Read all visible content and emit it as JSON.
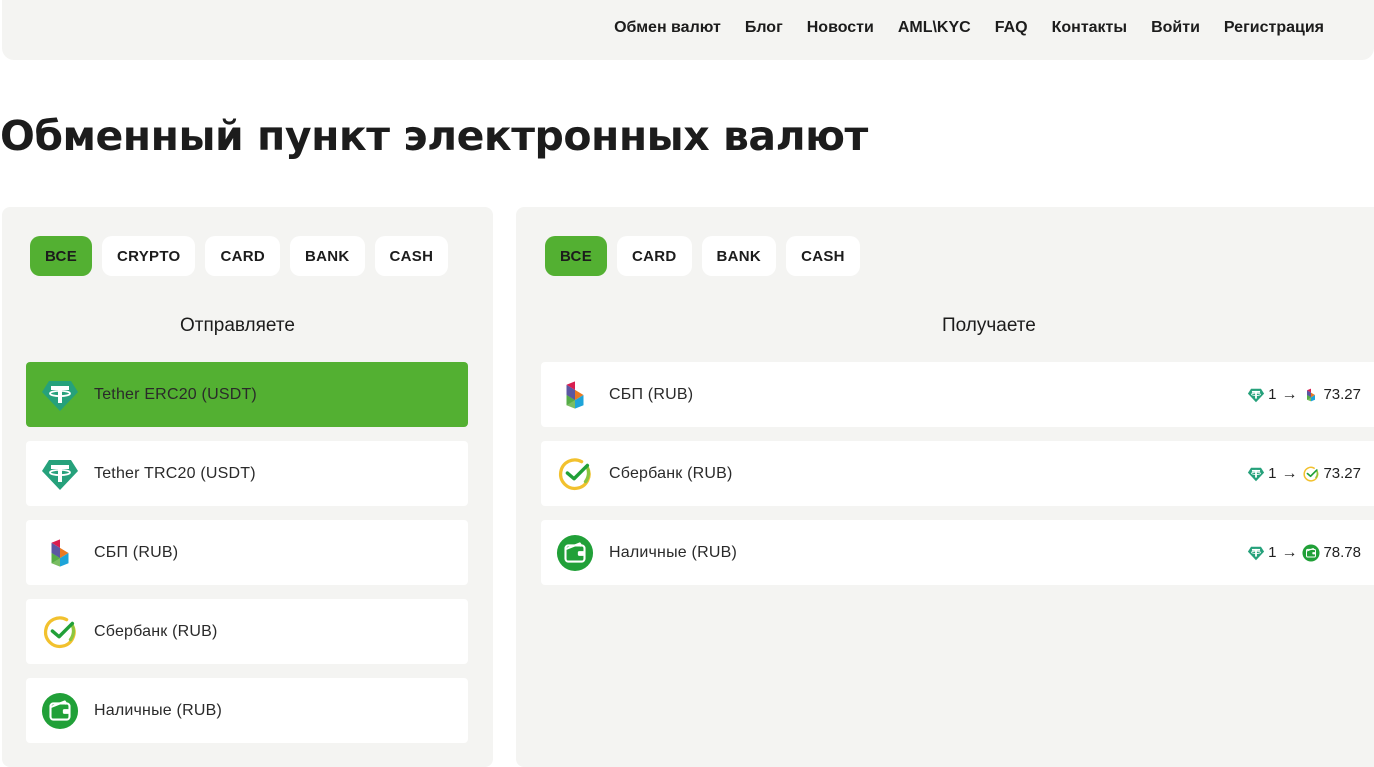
{
  "nav": {
    "items": [
      "Обмен валют",
      "Блог",
      "Новости",
      "AML\\KYC",
      "FAQ",
      "Контакты",
      "Войти",
      "Регистрация"
    ]
  },
  "page_title": "Обменный пункт электронных валют",
  "send": {
    "filters": [
      "ВСЕ",
      "CRYPTO",
      "CARD",
      "BANK",
      "CASH"
    ],
    "active_filter": "ВСЕ",
    "title": "Отправляете",
    "items": [
      {
        "label": "Tether ERC20 (USDT)",
        "icon": "tether-icon",
        "active": true
      },
      {
        "label": "Tether TRC20 (USDT)",
        "icon": "tether-icon",
        "active": false
      },
      {
        "label": "СБП (RUB)",
        "icon": "sbp-icon",
        "active": false
      },
      {
        "label": "Сбербанк (RUB)",
        "icon": "sberbank-icon",
        "active": false
      },
      {
        "label": "Наличные (RUB)",
        "icon": "cash-wallet-icon",
        "active": false
      }
    ]
  },
  "receive": {
    "filters": [
      "ВСЕ",
      "CARD",
      "BANK",
      "CASH"
    ],
    "active_filter": "ВСЕ",
    "title": "Получаете",
    "items": [
      {
        "label": "СБП (RUB)",
        "icon": "sbp-icon",
        "rate_from": "1",
        "rate_to": "73.27"
      },
      {
        "label": "Сбербанк (RUB)",
        "icon": "sberbank-icon",
        "rate_from": "1",
        "rate_to": "73.27"
      },
      {
        "label": "Наличные (RUB)",
        "icon": "cash-wallet-icon",
        "rate_from": "1",
        "rate_to": "78.78"
      }
    ]
  },
  "colors": {
    "accent": "#53b032",
    "panel_bg": "#f4f4f2",
    "tether": "#26a17b",
    "sber": "#21a038"
  }
}
